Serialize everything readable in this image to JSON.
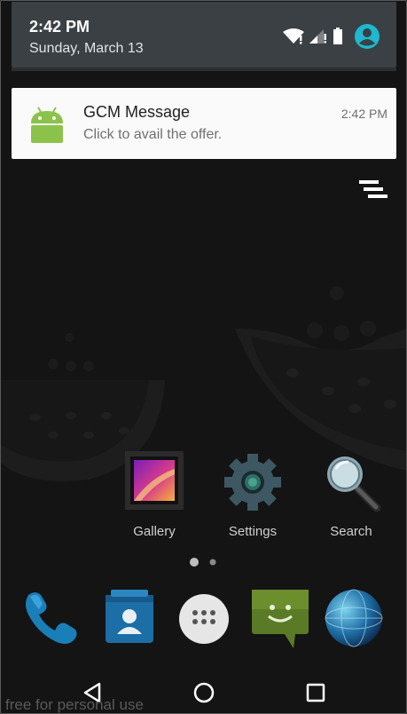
{
  "status": {
    "time": "2:42 PM",
    "date": "Sunday, March 13"
  },
  "notification": {
    "title": "GCM Message",
    "text": "Click to avail the offer.",
    "time": "2:42 PM",
    "icon": "android-robot-icon"
  },
  "apps": [
    {
      "label": "Gallery",
      "icon": "gallery-icon"
    },
    {
      "label": "Settings",
      "icon": "settings-gear-icon"
    },
    {
      "label": "Search",
      "icon": "magnifier-icon"
    }
  ],
  "dock": [
    {
      "icon": "phone-icon"
    },
    {
      "icon": "contacts-icon"
    },
    {
      "icon": "app-drawer-icon"
    },
    {
      "icon": "messaging-icon"
    },
    {
      "icon": "browser-globe-icon"
    }
  ],
  "watermark": "free for personal use",
  "colors": {
    "header_bg": "#3a4043",
    "notification_bg": "#fafafa",
    "accent_cyan": "#1eb8d0",
    "android_green": "#8bc34a",
    "background": "#141414"
  }
}
